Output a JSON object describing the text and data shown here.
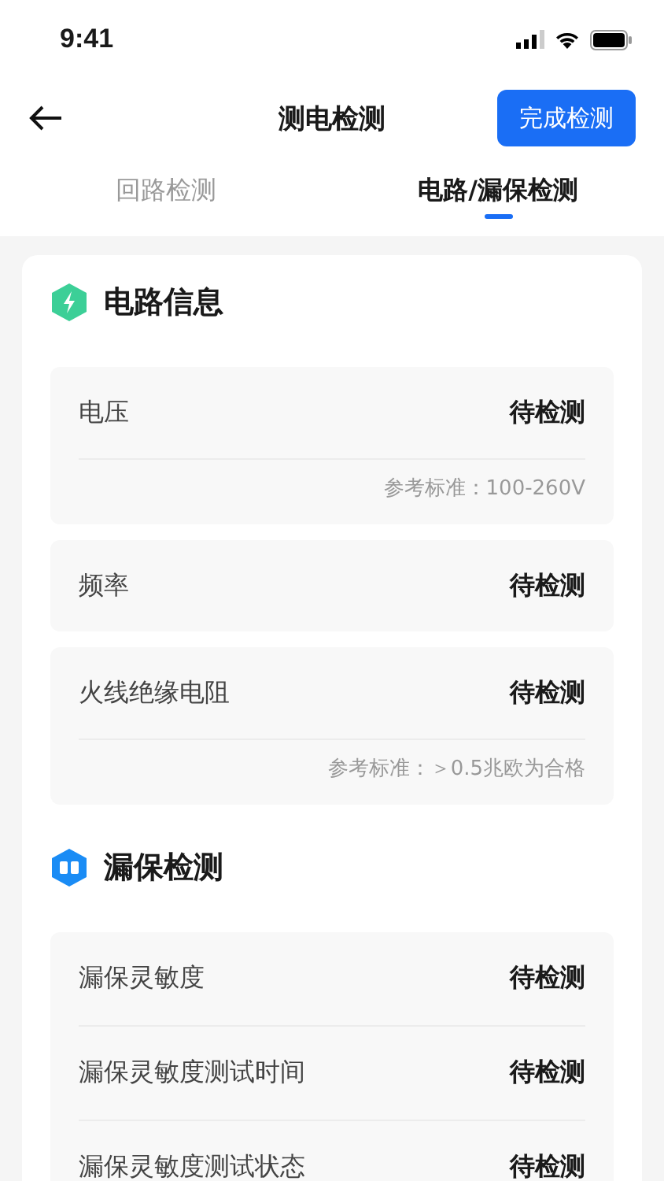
{
  "status_bar": {
    "time": "9:41"
  },
  "nav": {
    "title": "测电检测",
    "action": "完成检测"
  },
  "tabs": [
    {
      "label": "回路检测",
      "selected": false
    },
    {
      "label": "电路/漏保检测",
      "selected": true
    }
  ],
  "sections": [
    {
      "kind": "circuit",
      "title": "电路信息",
      "grouped": false,
      "items": [
        {
          "label": "电压",
          "value": "待检测",
          "note": "参考标准：100-260V"
        },
        {
          "label": "频率",
          "value": "待检测"
        },
        {
          "label": "火线绝缘电阻",
          "value": "待检测",
          "note": "参考标准：＞0.5兆欧为合格"
        }
      ]
    },
    {
      "kind": "leakage",
      "title": "漏保检测",
      "grouped": true,
      "items": [
        {
          "label": "漏保灵敏度",
          "value": "待检测"
        },
        {
          "label": "漏保灵敏度测试时间",
          "value": "待检测"
        },
        {
          "label": "漏保灵敏度测试状态",
          "value": "待检测"
        }
      ]
    }
  ]
}
